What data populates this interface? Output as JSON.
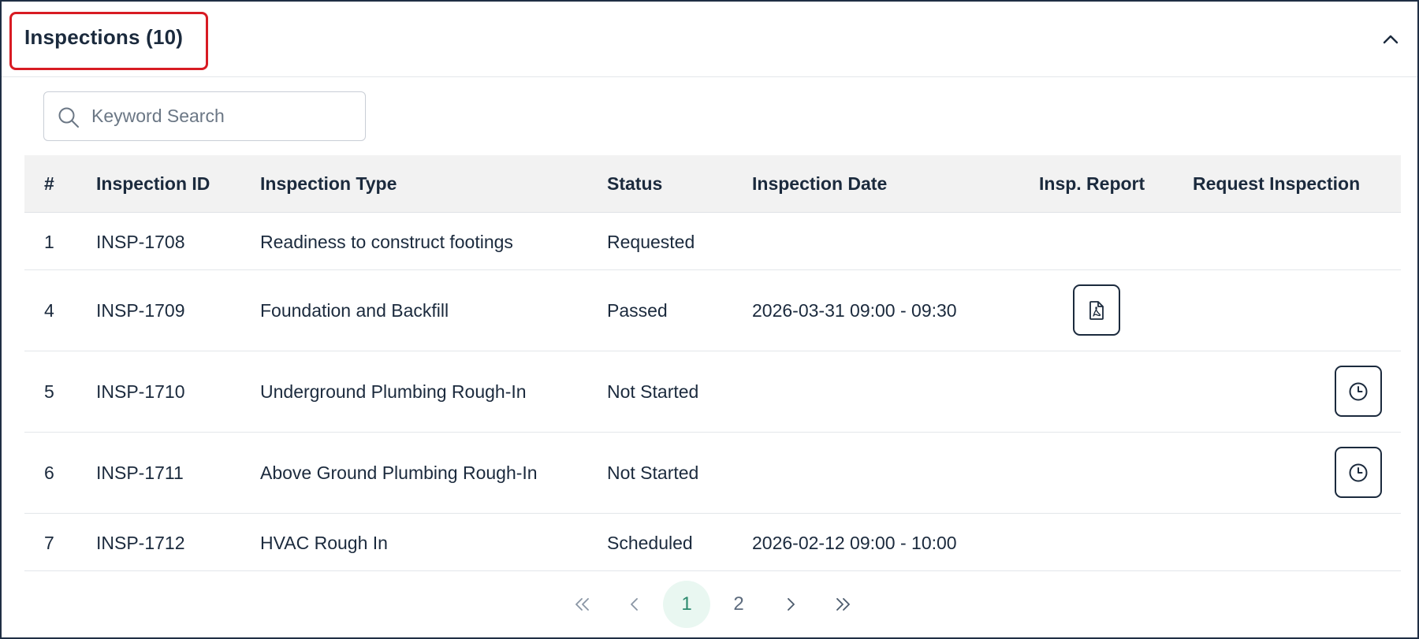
{
  "panel": {
    "title": "Inspections (10)",
    "collapse_icon": "chevron-up-icon"
  },
  "search": {
    "placeholder": "Keyword Search",
    "value": "",
    "icon": "search-icon"
  },
  "table": {
    "columns": [
      "#",
      "Inspection ID",
      "Inspection Type",
      "Status",
      "Inspection Date",
      "Insp. Report",
      "Request Inspection"
    ],
    "rows": [
      {
        "num": "1",
        "id": "INSP-1708",
        "type": "Readiness to construct footings",
        "status": "Requested",
        "date": "",
        "report": false,
        "request": false
      },
      {
        "num": "4",
        "id": "INSP-1709",
        "type": "Foundation and Backfill",
        "status": "Passed",
        "date": "2026-03-31 09:00 - 09:30",
        "report": true,
        "request": false
      },
      {
        "num": "5",
        "id": "INSP-1710",
        "type": "Underground Plumbing Rough-In",
        "status": "Not Started",
        "date": "",
        "report": false,
        "request": true
      },
      {
        "num": "6",
        "id": "INSP-1711",
        "type": "Above Ground Plumbing Rough-In",
        "status": "Not Started",
        "date": "",
        "report": false,
        "request": true
      },
      {
        "num": "7",
        "id": "INSP-1712",
        "type": "HVAC Rough In",
        "status": "Scheduled",
        "date": "2026-02-12 09:00 - 10:00",
        "report": false,
        "request": false
      }
    ],
    "report_icon": "pdf-file-icon",
    "request_icon": "clock-icon"
  },
  "pagination": {
    "first": "«",
    "prev": "‹",
    "pages": [
      "1",
      "2"
    ],
    "current": "1",
    "next": "›",
    "last": "»"
  },
  "colors": {
    "border": "#1f2e44",
    "highlight": "#d81b23",
    "header_bg": "#f2f2f2",
    "active_page_bg": "#e9f7f1",
    "active_page_text": "#2c8a6e"
  }
}
